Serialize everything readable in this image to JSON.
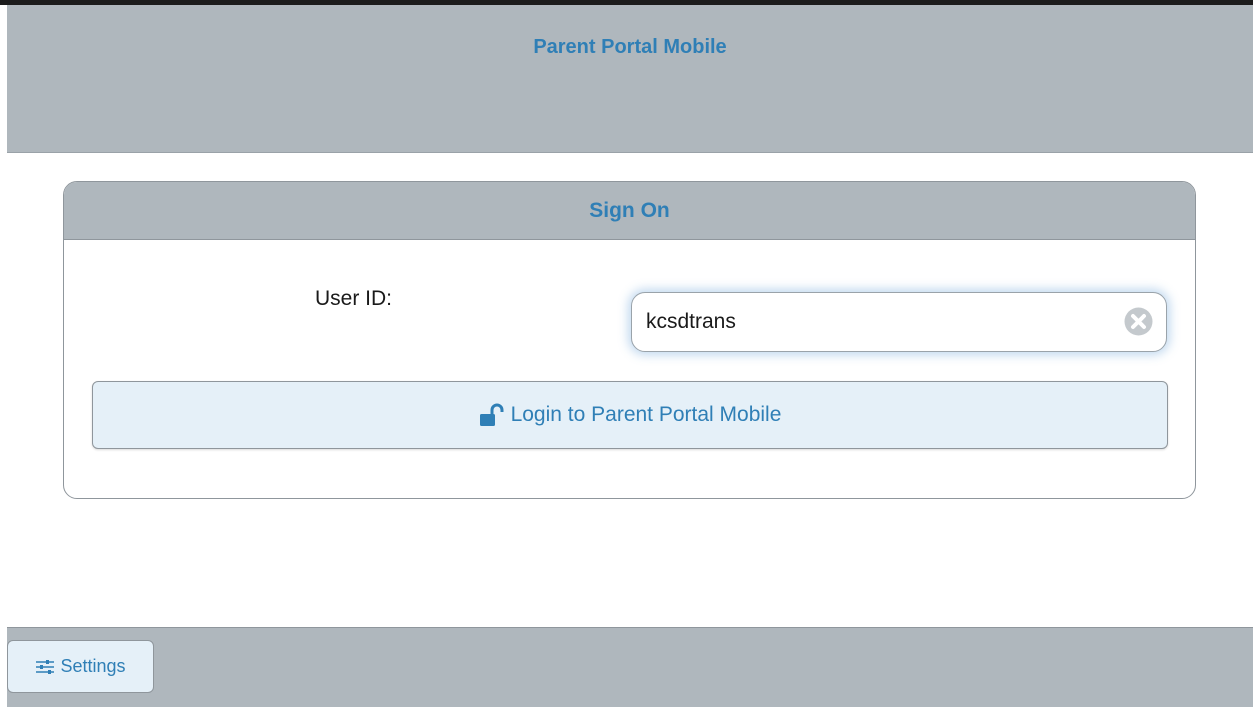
{
  "header": {
    "title": "Parent Portal Mobile"
  },
  "sign_on": {
    "title": "Sign On",
    "user_id_label": "User ID:",
    "user_id_value": "kcsdtrans",
    "login_button_label": "Login to Parent Portal Mobile",
    "login_icon": "unlock-icon",
    "clear_icon": "clear-icon"
  },
  "footer": {
    "settings_label": "Settings",
    "settings_icon": "sliders-icon"
  },
  "colors": {
    "accent": "#2f7fb6",
    "bar_background": "#afb7bd",
    "button_background": "#e5f0f8"
  }
}
